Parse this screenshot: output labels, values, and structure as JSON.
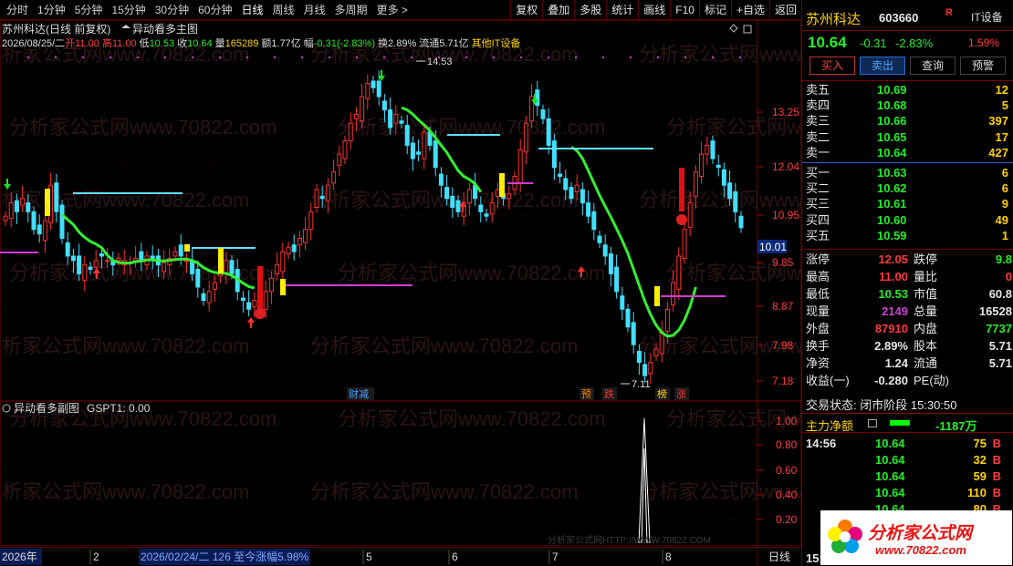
{
  "toolbar": {
    "tabs": [
      "分时",
      "1分钟",
      "5分钟",
      "15分钟",
      "30分钟",
      "60分钟",
      "日线",
      "周线",
      "月线",
      "多周期",
      "更多 >"
    ],
    "active_tab": "日线",
    "tools": [
      "复权",
      "叠加",
      "多股",
      "统计",
      "画线",
      "F10",
      "标记",
      "+自选",
      "返回"
    ]
  },
  "chart": {
    "title": "苏州科达(日线 前复权)",
    "indicator_name": "异动看多主图",
    "info": {
      "date": "2026/08/25/二",
      "open_label": "开",
      "open": "11.00",
      "high_label": "高",
      "high": "11.00",
      "low_label": "低",
      "low": "10.53",
      "close_label": "收",
      "close": "10.64",
      "vol_label": "量",
      "vol": "165289",
      "amount_label": "额",
      "amount": "1.77亿",
      "chg_label": "幅",
      "chg": "-0.31(-2.83%)",
      "turnover_label": "换",
      "turnover": "2.89%",
      "float_label": "流通",
      "float": "5.71亿",
      "sector": "其他IT设备"
    },
    "y_ticks": [
      "13.25",
      "12.04",
      "10.95",
      "9.85",
      "8.87",
      "7.98",
      "7.18"
    ],
    "current_price_tag": "10.01",
    "max_label": "14.53",
    "min_label": "7.11",
    "events": [
      {
        "text": "财减",
        "color": "#4aa0ff"
      },
      {
        "text": "预",
        "color": "#ff8800"
      },
      {
        "text": "跌",
        "color": "#ff3333"
      },
      {
        "text": "榜",
        "color": "#ffd200"
      },
      {
        "text": "涨",
        "color": "#ff3333"
      }
    ],
    "sub_title": "异动看多副图",
    "sub_value_label": "GSPT1: 0.00",
    "sub_ticks": [
      "1.00",
      "0.80",
      "0.60",
      "0.40",
      "0.20"
    ],
    "watermark": "分析家公式网www.70822.com",
    "bottom_watermark": "分析家公式网HTTP://WWW.70822.COM"
  },
  "chart_data": {
    "type": "candlestick",
    "y_axis_ticks": [
      13.25,
      12.04,
      10.95,
      9.85,
      8.87,
      7.98,
      7.18
    ],
    "max": 14.53,
    "min": 7.11,
    "last_close": 10.64,
    "x_month_labels": [
      "2026年",
      "2",
      "5",
      "6",
      "7",
      "8"
    ],
    "sub_series": {
      "name": "GSPT1",
      "last_value": 0.0,
      "peak_value": 1.0,
      "y_ticks": [
        1.0,
        0.8,
        0.6,
        0.4,
        0.2
      ]
    }
  },
  "bottombar": {
    "year": "2026年",
    "m2": "2",
    "range": "2026/02/24/二 126 至今涨幅5.98%",
    "m5": "5",
    "m6": "6",
    "m7": "7",
    "m8": "8",
    "period": "日线"
  },
  "quote": {
    "name": "苏州科达",
    "code": "603660",
    "r_badge": "R",
    "industry": "IT设备",
    "price": "10.64",
    "change": "-0.31",
    "pct": "-2.83%",
    "industry_pct": "1.59%",
    "buttons": [
      "买入",
      "卖出",
      "查询",
      "预警"
    ],
    "asks": [
      {
        "label": "卖五",
        "price": "10.69",
        "vol": "12"
      },
      {
        "label": "卖四",
        "price": "10.68",
        "vol": "5"
      },
      {
        "label": "卖三",
        "price": "10.66",
        "vol": "397"
      },
      {
        "label": "卖二",
        "price": "10.65",
        "vol": "17"
      },
      {
        "label": "卖一",
        "price": "10.64",
        "vol": "427"
      }
    ],
    "bids": [
      {
        "label": "买一",
        "price": "10.63",
        "vol": "6"
      },
      {
        "label": "买二",
        "price": "10.62",
        "vol": "6"
      },
      {
        "label": "买三",
        "price": "10.61",
        "vol": "9"
      },
      {
        "label": "买四",
        "price": "10.60",
        "vol": "49"
      },
      {
        "label": "买五",
        "price": "10.59",
        "vol": "1"
      }
    ],
    "stats": [
      {
        "l1": "涨停",
        "v1": "12.05",
        "c1": "#ff3b3b",
        "l2": "跌停",
        "v2": "9.8",
        "c2": "#22ee22"
      },
      {
        "l1": "最高",
        "v1": "11.00",
        "c1": "#ff3b3b",
        "l2": "量比",
        "v2": "0",
        "c2": "#ff3b3b"
      },
      {
        "l1": "最低",
        "v1": "10.53",
        "c1": "#22ee22",
        "l2": "市值",
        "v2": "60.8",
        "c2": "#e6e6e6"
      },
      {
        "l1": "现量",
        "v1": "2149",
        "c1": "#d040d0",
        "l2": "总量",
        "v2": "16528",
        "c2": "#e6e6e6"
      },
      {
        "l1": "外盘",
        "v1": "87910",
        "c1": "#ff3b3b",
        "l2": "内盘",
        "v2": "7737",
        "c2": "#22ee22"
      },
      {
        "l1": "换手",
        "v1": "2.89%",
        "c1": "#e6e6e6",
        "l2": "股本",
        "v2": "5.71",
        "c2": "#e6e6e6"
      },
      {
        "l1": "净资",
        "v1": "1.24",
        "c1": "#e6e6e6",
        "l2": "流通",
        "v2": "5.71",
        "c2": "#e6e6e6"
      },
      {
        "l1": "收益(一)",
        "v1": "-0.280",
        "c1": "#e6e6e6",
        "l2": "PE(动)",
        "v2": "",
        "c2": "#e6e6e6"
      }
    ],
    "trade_status": "交易状态: 闭市阶段 15:30:50",
    "flow_label": "主力净额",
    "flow_value": "-1187万",
    "ticks": [
      {
        "time": "14:56",
        "price": "10.64",
        "vol": "75",
        "bs": "B"
      },
      {
        "time": "",
        "price": "10.64",
        "vol": "32",
        "bs": "B"
      },
      {
        "time": "",
        "price": "10.64",
        "vol": "59",
        "bs": "B"
      },
      {
        "time": "",
        "price": "10.64",
        "vol": "110",
        "bs": "B"
      },
      {
        "time": "",
        "price": "10.64",
        "vol": "80",
        "bs": "B"
      }
    ],
    "last_tick_time": "15:00",
    "logo_text": "分析家公式网",
    "logo_url": "www.70822.com"
  }
}
